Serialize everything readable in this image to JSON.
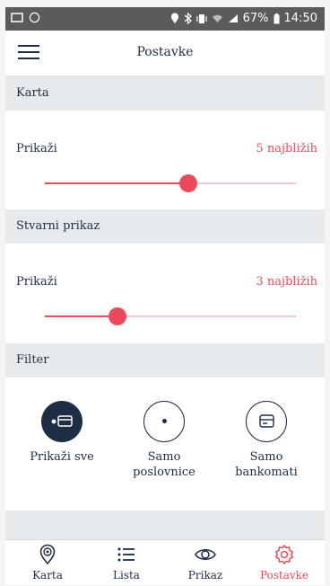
{
  "status_bar": {
    "battery": "67%",
    "time": "14:50"
  },
  "header": {
    "title": "Postavke"
  },
  "karta": {
    "section_title": "Karta",
    "label": "Prikaži",
    "value": "5 najbližih",
    "slider_level": 0.57
  },
  "stvarni": {
    "section_title": "Stvarni prikaz",
    "label": "Prikaži",
    "value": "3 najbližih",
    "slider_level": 0.29
  },
  "filter": {
    "section_title": "Filter",
    "options": [
      {
        "label": "Prikaži sve",
        "selected": true
      },
      {
        "label": "Samo poslovnice",
        "line1": "Samo",
        "line2": "poslovnice",
        "selected": false
      },
      {
        "label": "Samo bankomati",
        "line1": "Samo",
        "line2": "bankomati",
        "selected": false
      }
    ]
  },
  "tabs": [
    {
      "label": "Karta",
      "icon": "map-pin-icon"
    },
    {
      "label": "Lista",
      "icon": "list-icon"
    },
    {
      "label": "Prikaz",
      "icon": "eye-icon"
    },
    {
      "label": "Postavke",
      "icon": "gear-icon",
      "active": true
    }
  ],
  "colors": {
    "accent": "#e94b5c",
    "navy": "#1d2e44",
    "section_bg": "#e7eaed"
  }
}
